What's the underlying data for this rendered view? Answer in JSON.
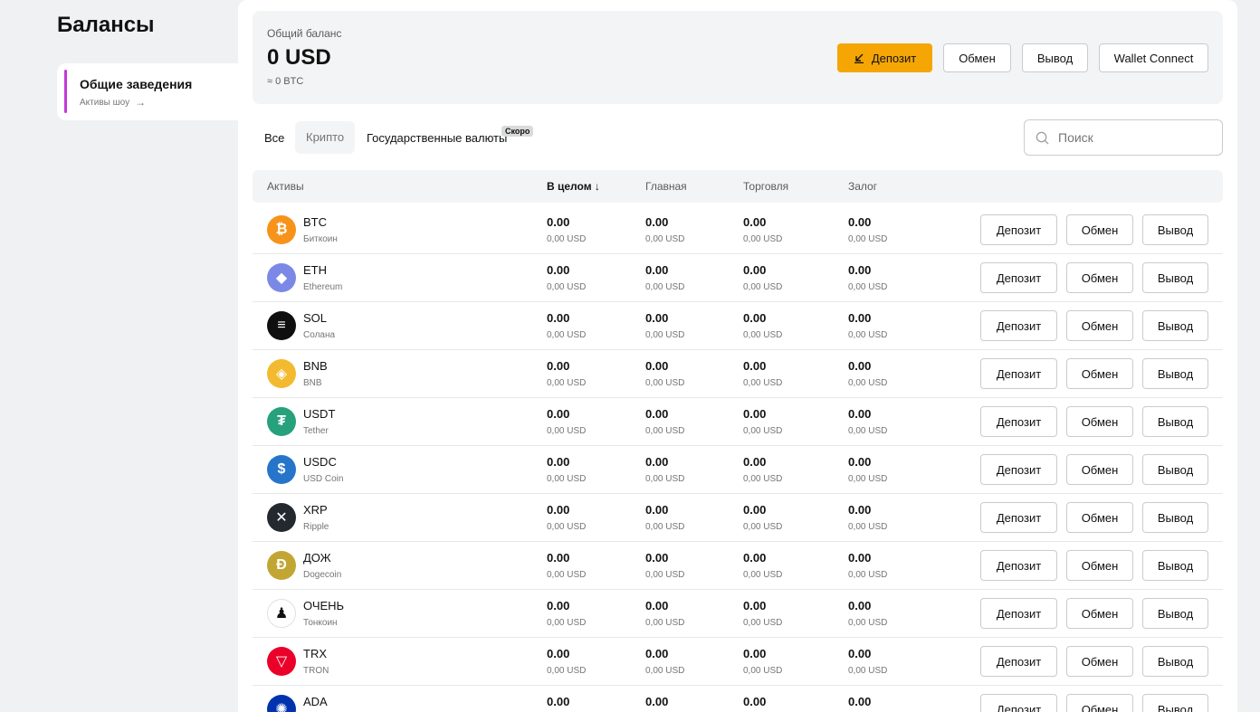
{
  "page_title": "Балансы",
  "sidebar": {
    "title": "Общие заведения",
    "subtitle": "Активы шоу"
  },
  "balance": {
    "label": "Общий баланс",
    "value": "0 USD",
    "btc": "≈ 0 BTC",
    "buttons": {
      "deposit": "Депозит",
      "exchange": "Обмен",
      "withdraw": "Вывод",
      "wallet_connect": "Wallet Connect"
    }
  },
  "filters": {
    "all": "Все",
    "crypto": "Крипто",
    "fiat": "Государственные валюты",
    "soon": "Скоро"
  },
  "search": {
    "placeholder": "Поиск"
  },
  "table": {
    "headers": {
      "assets": "Активы",
      "total": "В целом",
      "main": "Главная",
      "trade": "Торговля",
      "collateral": "Залог"
    },
    "row_buttons": {
      "deposit": "Депозит",
      "exchange": "Обмен",
      "withdraw": "Вывод"
    },
    "rows": [
      {
        "symbol": "BTC",
        "name": "Биткоин",
        "icon": "bitcoin-icon",
        "color": "#f7931a",
        "glyph": "₿",
        "total": "0.00",
        "total_usd": "0,00 USD",
        "main": "0.00",
        "main_usd": "0,00 USD",
        "trade": "0.00",
        "trade_usd": "0,00 USD",
        "collateral": "0.00",
        "collateral_usd": "0,00 USD"
      },
      {
        "symbol": "ETH",
        "name": "Ethereum",
        "icon": "ethereum-icon",
        "color": "#7c88e6",
        "glyph": "◆",
        "total": "0.00",
        "total_usd": "0,00 USD",
        "main": "0.00",
        "main_usd": "0,00 USD",
        "trade": "0.00",
        "trade_usd": "0,00 USD",
        "collateral": "0.00",
        "collateral_usd": "0,00 USD"
      },
      {
        "symbol": "SOL",
        "name": "Солана",
        "icon": "solana-icon",
        "color": "#0f0f0f",
        "glyph": "≡",
        "total": "0.00",
        "total_usd": "0,00 USD",
        "main": "0.00",
        "main_usd": "0,00 USD",
        "trade": "0.00",
        "trade_usd": "0,00 USD",
        "collateral": "0.00",
        "collateral_usd": "0,00 USD"
      },
      {
        "symbol": "BNB",
        "name": "BNB",
        "icon": "bnb-icon",
        "color": "#f3ba2f",
        "glyph": "◈",
        "total": "0.00",
        "total_usd": "0,00 USD",
        "main": "0.00",
        "main_usd": "0,00 USD",
        "trade": "0.00",
        "trade_usd": "0,00 USD",
        "collateral": "0.00",
        "collateral_usd": "0,00 USD"
      },
      {
        "symbol": "USDT",
        "name": "Tether",
        "icon": "tether-icon",
        "color": "#26a17b",
        "glyph": "₮",
        "total": "0.00",
        "total_usd": "0,00 USD",
        "main": "0.00",
        "main_usd": "0,00 USD",
        "trade": "0.00",
        "trade_usd": "0,00 USD",
        "collateral": "0.00",
        "collateral_usd": "0,00 USD"
      },
      {
        "symbol": "USDC",
        "name": "USD Coin",
        "icon": "usd-coin-icon",
        "color": "#2775ca",
        "glyph": "$",
        "total": "0.00",
        "total_usd": "0,00 USD",
        "main": "0.00",
        "main_usd": "0,00 USD",
        "trade": "0.00",
        "trade_usd": "0,00 USD",
        "collateral": "0.00",
        "collateral_usd": "0,00 USD"
      },
      {
        "symbol": "XRP",
        "name": "Ripple",
        "icon": "ripple-icon",
        "color": "#23292f",
        "glyph": "✕",
        "total": "0.00",
        "total_usd": "0,00 USD",
        "main": "0.00",
        "main_usd": "0,00 USD",
        "trade": "0.00",
        "trade_usd": "0,00 USD",
        "collateral": "0.00",
        "collateral_usd": "0,00 USD"
      },
      {
        "symbol": "ДОЖ",
        "name": "Dogecoin",
        "icon": "dogecoin-icon",
        "color": "#c2a633",
        "glyph": "Ð",
        "total": "0.00",
        "total_usd": "0,00 USD",
        "main": "0.00",
        "main_usd": "0,00 USD",
        "trade": "0.00",
        "trade_usd": "0,00 USD",
        "collateral": "0.00",
        "collateral_usd": "0,00 USD"
      },
      {
        "symbol": "ОЧЕНЬ",
        "name": "Тонкоин",
        "icon": "toncoin-icon",
        "color": "#ffffff",
        "glyph": "♟",
        "total": "0.00",
        "total_usd": "0,00 USD",
        "main": "0.00",
        "main_usd": "0,00 USD",
        "trade": "0.00",
        "trade_usd": "0,00 USD",
        "collateral": "0.00",
        "collateral_usd": "0,00 USD"
      },
      {
        "symbol": "TRX",
        "name": "TRON",
        "icon": "tron-icon",
        "color": "#eb0029",
        "glyph": "▽",
        "total": "0.00",
        "total_usd": "0,00 USD",
        "main": "0.00",
        "main_usd": "0,00 USD",
        "trade": "0.00",
        "trade_usd": "0,00 USD",
        "collateral": "0.00",
        "collateral_usd": "0,00 USD"
      },
      {
        "symbol": "ADA",
        "name": "",
        "icon": "cardano-icon",
        "color": "#0033ad",
        "glyph": "✺",
        "total": "0.00",
        "total_usd": "",
        "main": "0.00",
        "main_usd": "",
        "trade": "0.00",
        "trade_usd": "",
        "collateral": "0.00",
        "collateral_usd": ""
      }
    ]
  }
}
